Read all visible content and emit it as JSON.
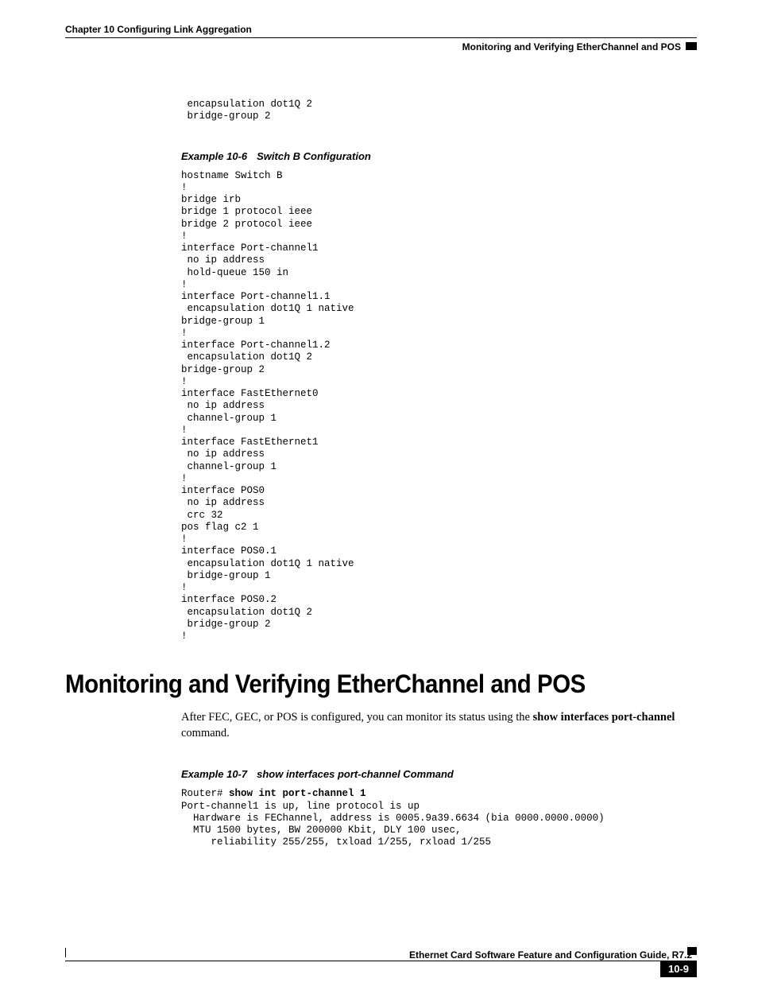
{
  "header": {
    "chapter": "Chapter 10 Configuring Link Aggregation",
    "section_label": "Monitoring and Verifying EtherChannel and POS"
  },
  "code_intro": " encapsulation dot1Q 2\n bridge-group 2",
  "example_10_6": {
    "num": "Example 10-6",
    "title": "Switch B Configuration",
    "code": "hostname Switch B\n!\nbridge irb\nbridge 1 protocol ieee\nbridge 2 protocol ieee\n!\ninterface Port-channel1\n no ip address\n hold-queue 150 in\n!\ninterface Port-channel1.1\n encapsulation dot1Q 1 native\nbridge-group 1\n!\ninterface Port-channel1.2\n encapsulation dot1Q 2\nbridge-group 2\n!\ninterface FastEthernet0\n no ip address\n channel-group 1\n!\ninterface FastEthernet1\n no ip address\n channel-group 1\n!\ninterface POS0\n no ip address\n crc 32\npos flag c2 1\n!\ninterface POS0.1\n encapsulation dot1Q 1 native\n bridge-group 1\n!\ninterface POS0.2\n encapsulation dot1Q 2\n bridge-group 2\n!"
  },
  "section_heading": "Monitoring and Verifying EtherChannel and POS",
  "body": {
    "pre": "After FEC, GEC, or POS is configured, you can monitor its status using the ",
    "cmd": "show interfaces port-channel",
    "post": " command."
  },
  "example_10_7": {
    "num": "Example 10-7",
    "title": "show interfaces port-channel Command",
    "prompt": "Router# ",
    "cmd": "show int port-channel 1",
    "output": "Port-channel1 is up, line protocol is up\n  Hardware is FEChannel, address is 0005.9a39.6634 (bia 0000.0000.0000)\n  MTU 1500 bytes, BW 200000 Kbit, DLY 100 usec,\n     reliability 255/255, txload 1/255, rxload 1/255"
  },
  "footer": {
    "guide": "Ethernet Card Software Feature and Configuration Guide, R7.2",
    "page": "10-9"
  }
}
